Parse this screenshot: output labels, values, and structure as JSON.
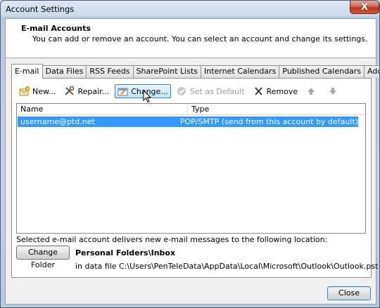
{
  "window": {
    "title": "Account Settings",
    "close_glyph": "X"
  },
  "header": {
    "title": "E-mail Accounts",
    "description": "You can add or remove an account. You can select an account and change its settings."
  },
  "tabs": [
    {
      "label": "E-mail",
      "active": true
    },
    {
      "label": "Data Files"
    },
    {
      "label": "RSS Feeds"
    },
    {
      "label": "SharePoint Lists"
    },
    {
      "label": "Internet Calendars"
    },
    {
      "label": "Published Calendars"
    },
    {
      "label": "Address Books"
    }
  ],
  "toolbar": {
    "new_label": "New...",
    "repair_label": "Repair...",
    "change_label": "Change...",
    "set_default_label": "Set as Default",
    "remove_label": "Remove",
    "move_up_icon": "arrow-up-icon",
    "move_down_icon": "arrow-down-icon"
  },
  "list": {
    "columns": [
      "Name",
      "Type"
    ],
    "rows": [
      {
        "name": "username@ptd.net",
        "type": "POP/SMTP (send from this account by default)",
        "selected": true
      }
    ]
  },
  "delivery": {
    "text": "Selected e-mail account delivers new e-mail messages to the following location:",
    "change_folder_label": "Change Folder",
    "folder_name": "Personal Folders\\Inbox",
    "data_file": "in data file C:\\Users\\PenTeleData\\AppData\\Local\\Microsoft\\Outlook\\Outlook.pst"
  },
  "footer": {
    "close_label": "Close"
  },
  "colors": {
    "selection": "#3399ff",
    "title_close": "#c9432b"
  }
}
